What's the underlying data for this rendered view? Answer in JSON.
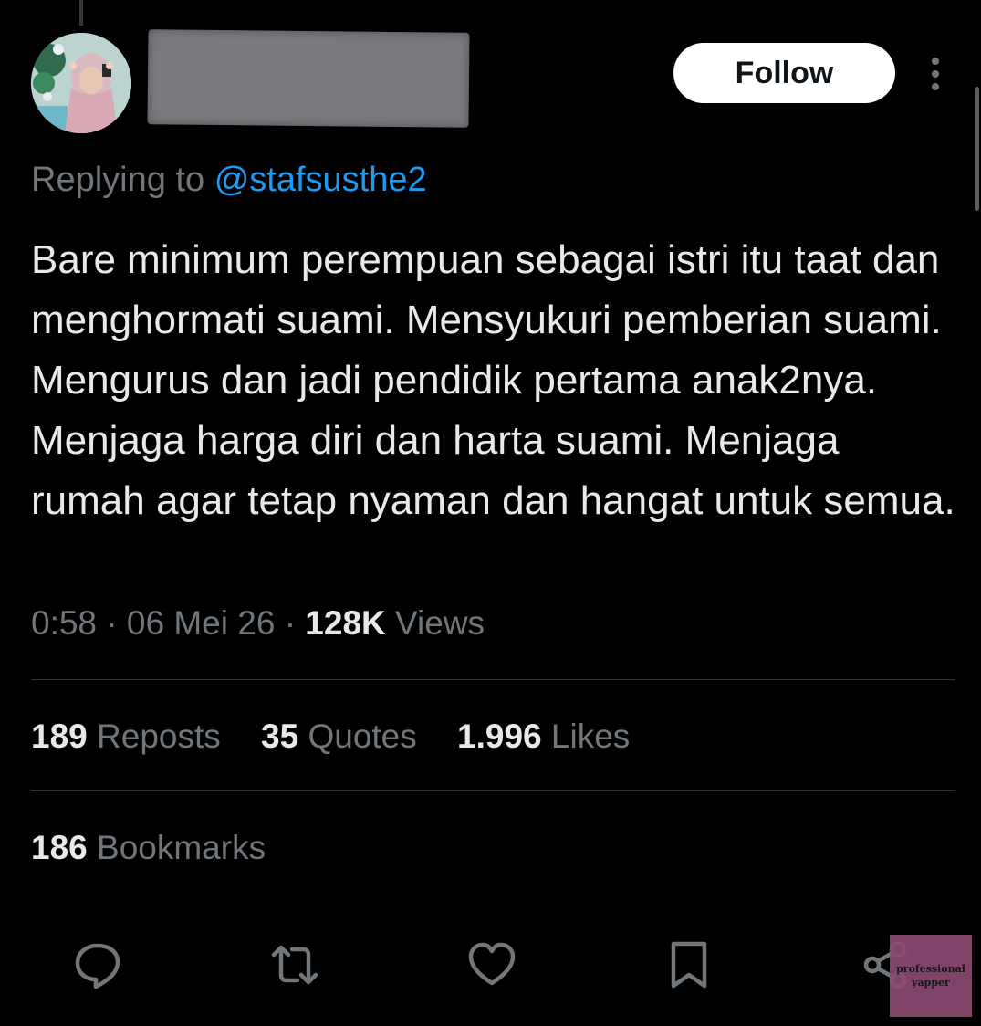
{
  "header": {
    "follow_label": "Follow"
  },
  "reply": {
    "prefix": "Replying to",
    "handle": "@stafsusthe2"
  },
  "tweet": {
    "text": "Bare minimum perempuan sebagai istri itu taat dan menghormati suami. Mensyukuri pemberian suami. Mengurus dan jadi pendidik pertama anak2nya. Menjaga harga diri dan harta suami. Menjaga rumah agar tetap nyaman dan hangat untuk semua.",
    "time": "0:58",
    "date": "06 Mei 26",
    "views_count": "128K",
    "views_label": "Views",
    "separator": "·"
  },
  "stats": {
    "reposts": {
      "count": "189",
      "label": "Reposts"
    },
    "quotes": {
      "count": "35",
      "label": "Quotes"
    },
    "likes": {
      "count": "1.996",
      "label": "Likes"
    },
    "bookmarks": {
      "count": "186",
      "label": "Bookmarks"
    }
  },
  "actions": [
    "reply-icon",
    "repost-icon",
    "like-icon",
    "bookmark-icon",
    "share-icon"
  ],
  "watermark": {
    "line1": "professional",
    "line2": "yapper"
  },
  "colors": {
    "background": "#000000",
    "text_primary": "#e7e9ea",
    "text_secondary": "#71767b",
    "link": "#1d9bf0",
    "divider": "#2f3336"
  }
}
